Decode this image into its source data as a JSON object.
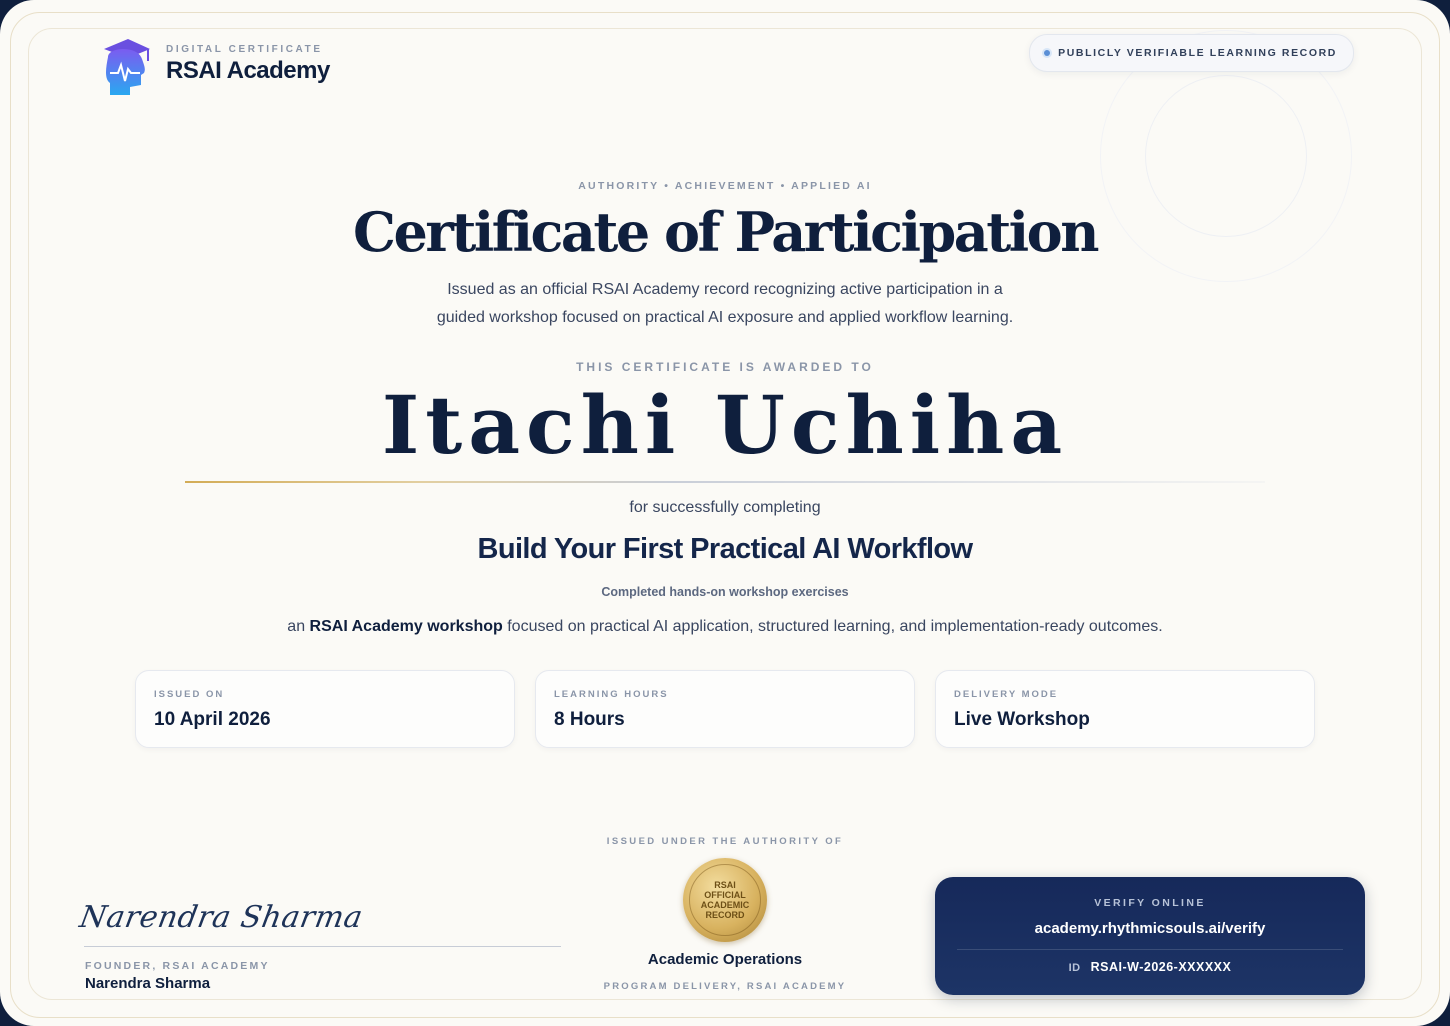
{
  "header": {
    "kicker": "DIGITAL CERTIFICATE",
    "brand_name": "RSAI Academy",
    "verify_pill": "PUBLICLY VERIFIABLE LEARNING RECORD"
  },
  "certificate": {
    "kicker": "AUTHORITY • ACHIEVEMENT • APPLIED AI",
    "title": "Certificate of Participation",
    "intro_line1": "Issued as an official RSAI Academy record recognizing active participation in a",
    "intro_line2": "guided workshop focused on practical AI exposure and applied workflow learning.",
    "awarded_label": "THIS CERTIFICATE IS AWARDED TO",
    "recipient": "Itachi Uchiha",
    "for_text": "for successfully completing",
    "course": "Build Your First Practical AI Workflow",
    "course_sub": "Completed hands-on workshop exercises",
    "desc_prefix": "an ",
    "desc_bold": "RSAI Academy workshop",
    "desc_suffix": " focused on practical AI application, structured learning, and implementation-ready outcomes."
  },
  "details": [
    {
      "label": "ISSUED ON",
      "value": "10 April 2026"
    },
    {
      "label": "LEARNING HOURS",
      "value": "8 Hours"
    },
    {
      "label": "DELIVERY MODE",
      "value": "Live Workshop"
    }
  ],
  "signatory": {
    "signature": "Narendra Sharma",
    "role": "FOUNDER, RSAI ACADEMY",
    "name": "Narendra Sharma"
  },
  "authority": {
    "label": "ISSUED UNDER THE AUTHORITY OF",
    "seal_line1": "RSAI",
    "seal_line2": "OFFICIAL",
    "seal_line3": "ACADEMIC",
    "seal_line4": "RECORD",
    "department": "Academic Operations",
    "sub": "PROGRAM DELIVERY, RSAI ACADEMY"
  },
  "verify": {
    "label": "VERIFY ONLINE",
    "url": "academy.rhythmicsouls.ai/verify",
    "id_key": "ID",
    "id_value": "RSAI-W-2026-XXXXXX"
  },
  "colors": {
    "navy": "#0f1f3d",
    "gold": "#d3ac56",
    "muted": "#8a95a8"
  }
}
